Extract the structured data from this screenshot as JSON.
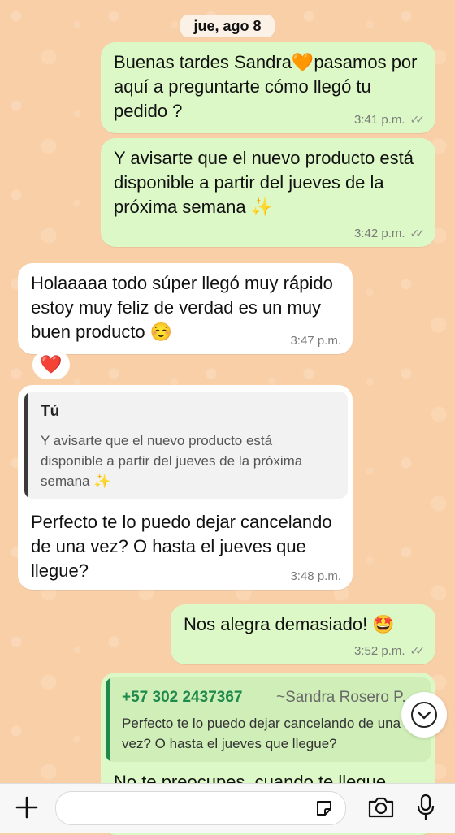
{
  "date_chip": "jue, ago 8",
  "messages": [
    {
      "text": "Buenas tardes Sandra🧡pasamos por aquí a preguntarte cómo llegó tu pedido ?",
      "time": "3:41 p.m.",
      "ticks": "✓✓"
    },
    {
      "text": "Y avisarte que el nuevo producto está disponible a partir del jueves de la próxima semana ✨",
      "time": "3:42 p.m.",
      "ticks": "✓✓"
    },
    {
      "text": "Holaaaaa todo súper llegó muy rápido estoy muy feliz de verdad es un muy buen producto ☺️",
      "time": "3:47 p.m.",
      "reaction": "❤️"
    },
    {
      "quote_name": "Tú",
      "quote_text": "Y avisarte que el nuevo producto está disponible a partir del jueves de la próxima semana ✨",
      "text": "Perfecto te lo puedo dejar cancelando de una vez? O hasta el jueves que llegue?",
      "time": "3:48 p.m."
    },
    {
      "text": "Nos alegra demasiado! 🤩",
      "time": "3:52 p.m.",
      "ticks": "✓✓"
    },
    {
      "quote_name": "+57 302 2437367",
      "quote_sub": "~Sandra Rosero P.",
      "quote_text": "Perfecto te lo puedo dejar cancelando de una vez? O hasta el jueves que llegue?",
      "text": "No te preocupes, cuando te llegue"
    }
  ],
  "colors": {
    "outgoing": "#dcf8c6",
    "incoming": "#ffffff",
    "wallpaper": "#f9cfa7",
    "quote_accent": "#1f8a4c"
  },
  "icons": {
    "plus": "plus-icon",
    "sticker": "sticker-icon",
    "camera": "camera-icon",
    "mic": "mic-icon",
    "scroll": "chevron-down-icon"
  }
}
